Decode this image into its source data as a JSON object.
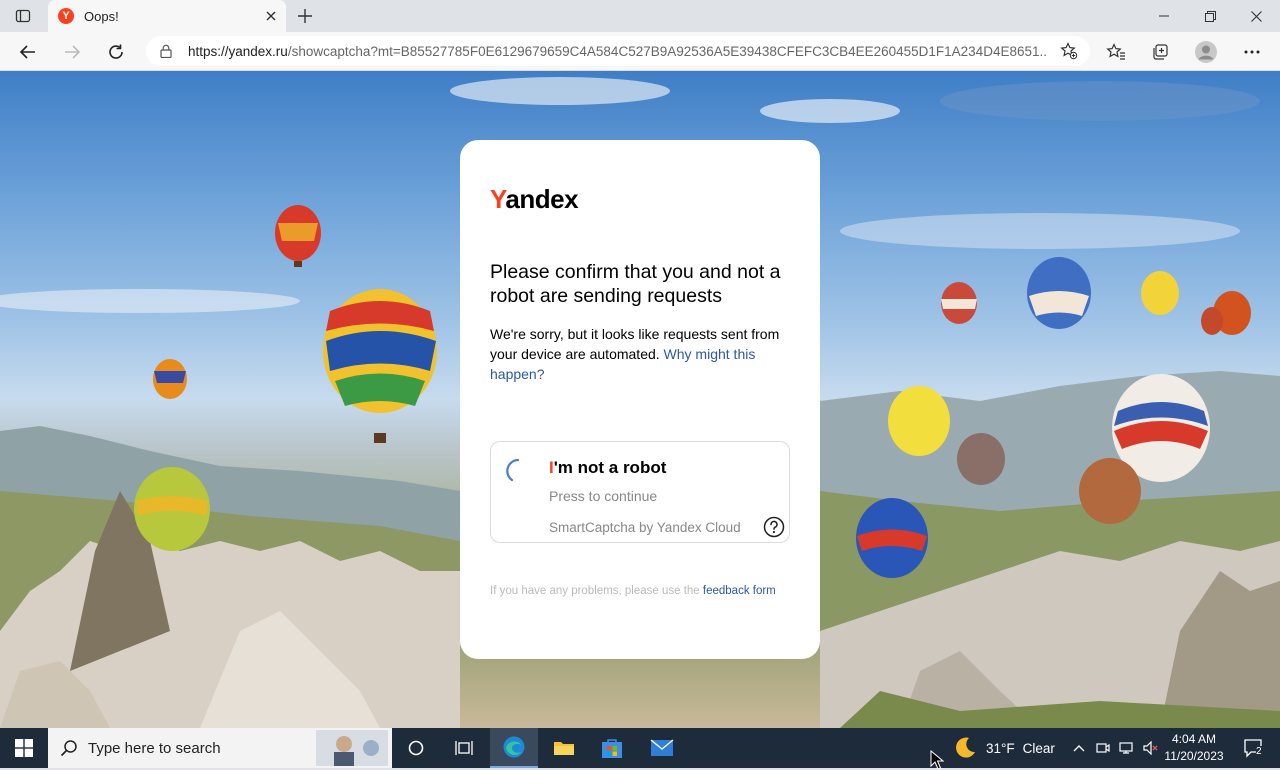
{
  "browser": {
    "tab_title": "Oops!",
    "favicon_letter": "Y",
    "url_host": "https://yandex.ru",
    "url_path": "/showcaptcha?mt=B85527785F0E6129679659C4A584C527B9A92536A5E39438CFEFC3CB4EE260455D1F1A234D4E8651..."
  },
  "card": {
    "logo_first": "Y",
    "logo_rest": "andex",
    "heading": "Please confirm that you and not a robot are sending requests",
    "desc_text": "We're sorry, but it looks like requests sent from your device are automated.",
    "desc_link": "Why might this happen?",
    "captcha": {
      "title_first": "I",
      "title_rest": "'m not a robot",
      "subtitle": "Press to continue",
      "brand": "SmartCaptcha by Yandex Cloud"
    },
    "footer_text": "If you have any problems, please use the",
    "footer_link": "feedback form"
  },
  "taskbar": {
    "search_placeholder": "Type here to search",
    "weather_temp": "31°F",
    "weather_desc": "Clear",
    "time": "4:04 AM",
    "date": "11/20/2023",
    "notifications_count": "2"
  },
  "colors": {
    "brand_red": "#fc3f1d",
    "link_blue": "#2a59a5",
    "taskbar_bg": "#1e2b3a"
  }
}
